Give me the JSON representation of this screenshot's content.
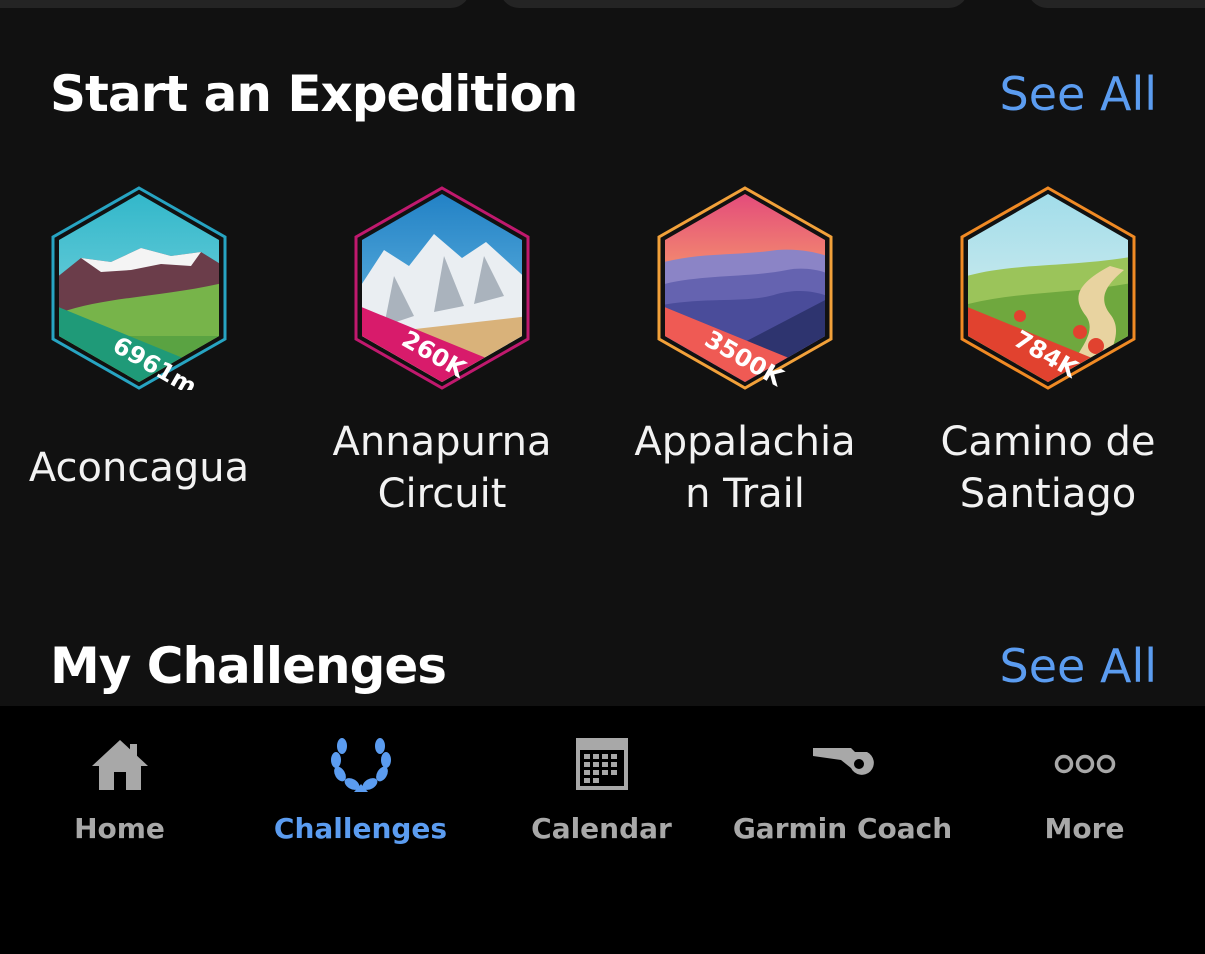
{
  "sections": {
    "expeditions": {
      "title": "Start an Expedition",
      "see_all": "See All"
    },
    "challenges": {
      "title": "My Challenges",
      "see_all": "See All"
    }
  },
  "expeditions": [
    {
      "name_line1": "Aconcagua",
      "name_line2": "",
      "badge_text": "6961m",
      "badge_color": "#1f9a78",
      "frame_color": "#27a4c2"
    },
    {
      "name_line1": "Annapurna",
      "name_line2": "Circuit",
      "badge_text": "260K",
      "badge_color": "#d81b6b",
      "frame_color": "#c0196e"
    },
    {
      "name_line1": "Appalachia",
      "name_line2": "n Trail",
      "badge_text": "3500K",
      "badge_color": "#ef5a54",
      "frame_color": "#f2a13a"
    },
    {
      "name_line1": "Camino de",
      "name_line2": "Santiago",
      "badge_text": "784K",
      "badge_color": "#e1422f",
      "frame_color": "#f08a24"
    }
  ],
  "tabbar": {
    "active_color": "#5b9cf0",
    "inactive_color": "#a8a8a8",
    "items": [
      {
        "label": "Home",
        "icon": "home-icon"
      },
      {
        "label": "Challenges",
        "icon": "laurel-icon",
        "active": true
      },
      {
        "label": "Calendar",
        "icon": "calendar-icon"
      },
      {
        "label": "Garmin Coach",
        "icon": "whistle-icon"
      },
      {
        "label": "More",
        "icon": "more-icon"
      }
    ]
  }
}
